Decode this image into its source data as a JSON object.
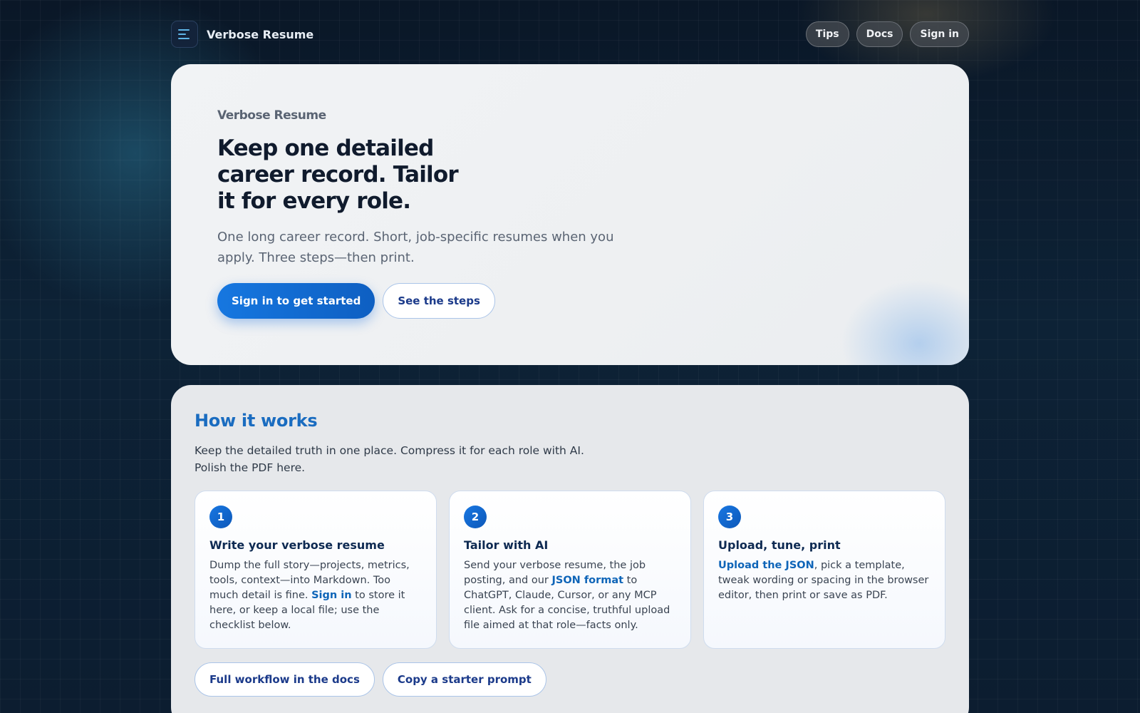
{
  "header": {
    "brand_name": "Verbose Resume",
    "menu_icon": "hamburger-menu-icon",
    "nav": [
      "Tips",
      "Docs",
      "Sign in"
    ]
  },
  "hero": {
    "eyebrow": "Verbose Resume",
    "title": "Keep one detailed career record. Tailor it for every role.",
    "subtitle": "One long career record. Short, job-specific resumes when you apply. Three steps—then print.",
    "primary_button": "Sign in to get started",
    "secondary_button": "See the steps"
  },
  "how_it_works": {
    "title": "How it works",
    "subtitle": "Keep the detailed truth in one place. Compress it for each role with AI. Polish the PDF here.",
    "steps": [
      {
        "number": "1",
        "title": "Write your verbose resume",
        "text_before": "Dump the full story—projects, metrics, tools, context—into Markdown. Too much detail is fine. ",
        "link": "Sign in",
        "text_after": " to store it here, or keep a local file; use the checklist below."
      },
      {
        "number": "2",
        "title": "Tailor with AI",
        "text_before": "Send your verbose resume, the job posting, and our ",
        "link": "JSON format",
        "text_after": " to ChatGPT, Claude, Cursor, or any MCP client. Ask for a concise, truthful upload file aimed at that role—facts only."
      },
      {
        "number": "3",
        "title": "Upload, tune, print",
        "text_before": "",
        "link": "Upload the JSON",
        "text_after": ", pick a template, tweak wording or spacing in the browser editor, then print or save as PDF."
      }
    ],
    "docs_button": "Full workflow in the docs",
    "prompt_button": "Copy a starter prompt"
  },
  "colors": {
    "accent": "#1677e0",
    "heading_accent": "#1a6cc0",
    "link": "#0f65b8",
    "page_background": "#0b1a2b"
  }
}
